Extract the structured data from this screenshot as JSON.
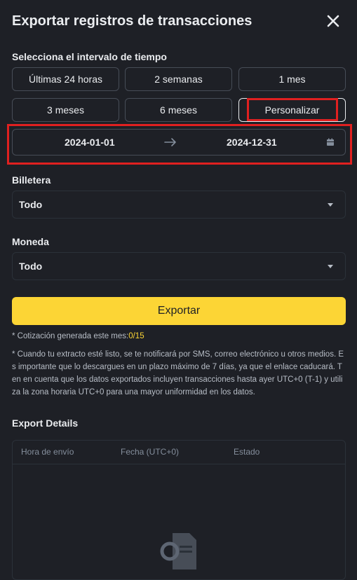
{
  "header": {
    "title": "Exportar registros de transacciones"
  },
  "time_range": {
    "label": "Selecciona el intervalo de tiempo",
    "options": [
      "Últimas 24 horas",
      "2 semanas",
      "1 mes",
      "3 meses",
      "6 meses",
      "Personalizar"
    ],
    "selected": "Personalizar",
    "start_date": "2024-01-01",
    "end_date": "2024-12-31"
  },
  "wallet": {
    "label": "Billetera",
    "value": "Todo"
  },
  "currency": {
    "label": "Moneda",
    "value": "Todo"
  },
  "export_button": "Exportar",
  "notes": {
    "quota_prefix": "* Cotización generada este mes:",
    "quota_value": "0/15",
    "info": "* Cuando tu extracto esté listo, se te notificará por SMS, correo electrónico u otros medios. Es importante que lo descargues en un plazo máximo de 7 días, ya que el enlace caducará. Ten en cuenta que los datos exportados incluyen transacciones hasta ayer UTC+0 (T-1) y utiliza la zona horaria UTC+0 para una mayor uniformidad en los datos."
  },
  "export_details": {
    "title": "Export Details",
    "columns": [
      "Hora de envío",
      "Fecha (UTC+0)",
      "Estado"
    ]
  },
  "colors": {
    "accent": "#fcd535",
    "background": "#1e2026",
    "highlight_box": "#e02020"
  }
}
